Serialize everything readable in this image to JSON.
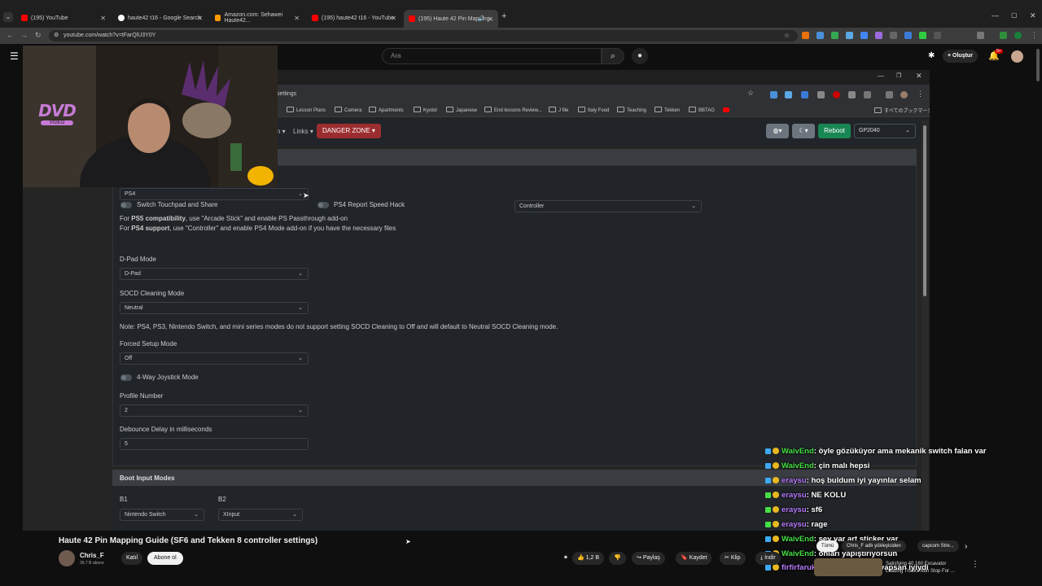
{
  "browser": {
    "tabs": [
      {
        "title": "(195) YouTube",
        "color": "#ff0000"
      },
      {
        "title": "haute42 t16 - Google Search",
        "color": "#ffffff"
      },
      {
        "title": "Amazon.com: Sehawei Haute42...",
        "color": "#ff9900"
      },
      {
        "title": "(195) haute42 t16 - YouTube",
        "color": "#ff0000"
      },
      {
        "title": "(195) Haute 42 Pin Mapping...",
        "color": "#ff0000"
      }
    ],
    "url": "youtube.com/watch?v=tFarQlU3Y0Y"
  },
  "youtube": {
    "search_placeholder": "Ara",
    "create_label": "Oluştur",
    "notif_count": "9+"
  },
  "inner_browser": {
    "address": "settings",
    "bookmarks": [
      "Lesson Plans",
      "Camera",
      "Apartments",
      "Kyotol",
      "Japanese",
      "End lessons Review...",
      "J file",
      "Italy Food",
      "Teaching",
      "Tekken",
      "BBTAG",
      "すべてのブックマーク"
    ]
  },
  "app": {
    "nav": {
      "links_label": "Links ▾",
      "prev_label": "n ▾",
      "danger_label": "DANGER ZONE ▾",
      "reboot_label": "Reboot",
      "board": "GP2040"
    },
    "settings": {
      "input_mode_value": "PS4",
      "switch_touchpad_label": "Switch Touchpad and Share",
      "ps4_speed_label": "PS4 Report Speed Hack",
      "controller_value": "Controller",
      "ps5_note": {
        "pre": "For ",
        "bold": "PS5 compatibility",
        "post": ", use \"Arcade Stick\" and enable PS Passthrough add-on"
      },
      "ps4_note": {
        "pre": "For ",
        "bold": "PS4 support",
        "post": ", use \"Controller\" and enable PS4 Mode add-on if you have the necessary files"
      },
      "dpad_label": "D-Pad Mode",
      "dpad_value": "D-Pad",
      "socd_label": "SOCD Cleaning Mode",
      "socd_value": "Neutral",
      "socd_note": "Note: PS4, PS3, Nintendo Switch, and mini series modes do not support setting SOCD Cleaning to Off and will default to Neutral SOCD Cleaning mode.",
      "forced_label": "Forced Setup Mode",
      "forced_value": "Off",
      "joystick_label": "4-Way Joystick Mode",
      "profile_label": "Profile Number",
      "profile_value": "2",
      "debounce_label": "Debounce Delay in milliseconds",
      "debounce_value": "5"
    },
    "boot": {
      "title": "Boot Input Modes",
      "b1_label": "B1",
      "b1_value": "Nintendo Switch",
      "b2_label": "B2",
      "b2_value": "XInput"
    }
  },
  "overlay": {
    "dvd_logo": "DVD",
    "dvd_sub": "VIDEO"
  },
  "chat": [
    {
      "user": "WaivEnd",
      "msg": ": öyle gözüküyor ama mekanik switch falan var",
      "color": "green"
    },
    {
      "user": "WaivEnd",
      "msg": ": çin malı hepsi",
      "color": "green"
    },
    {
      "user": "eraysu",
      "msg": ": hoş buldum iyi yayınlar selam",
      "color": "purple"
    },
    {
      "user": "eraysu",
      "msg": ": NE KOLU",
      "color": "purple"
    },
    {
      "user": "eraysu",
      "msg": ": sf6",
      "color": "purple"
    },
    {
      "user": "eraysu",
      "msg": ": rage",
      "color": "purple"
    },
    {
      "user": "WaivEnd",
      "msg": ": sey var art sticker var",
      "color": "green"
    },
    {
      "user": "WaivEnd",
      "msg": ": onları yapıştırıyorsun",
      "color": "green"
    },
    {
      "user": "firfirfaruk",
      "msg": ": dayı sinekkaydı yapsan iyiydi",
      "color": "purple"
    }
  ],
  "video": {
    "title": "Haute 42 Pin Mapping Guide (SF6 and Tekken 8 controller settings)",
    "channel": "Chris_F",
    "subs": "39,7 B abone",
    "join_label": "Katıl",
    "subscribe_label": "Abone ol",
    "likes": "1,2 B",
    "share_label": "Paylaş",
    "save_label": "Kaydet",
    "clip_label": "Klip",
    "download_label": "İndir",
    "chips": [
      "Tümü",
      "Chris_F adlı yükleyiciden",
      "capcom Stre..."
    ],
    "rec_titles": [
      "Satisfying 40,160 Excavator",
      "Loading Trucks Non Stop For ..."
    ]
  }
}
